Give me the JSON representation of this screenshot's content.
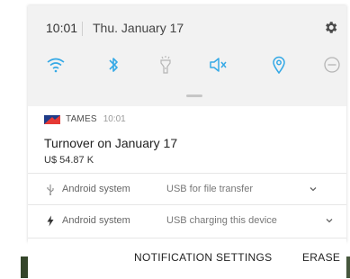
{
  "status": {
    "time": "10:01",
    "date": "Thu. January 17"
  },
  "quick_settings": [
    {
      "name": "wifi",
      "active": true
    },
    {
      "name": "bluetooth",
      "active": true
    },
    {
      "name": "flashlight",
      "active": false
    },
    {
      "name": "sound-off",
      "active": true
    },
    {
      "name": "location",
      "active": true
    },
    {
      "name": "do-not-disturb",
      "active": false
    }
  ],
  "notification": {
    "app": "TAMES",
    "time": "10:01",
    "title": "Turnover on January 17",
    "body": "U$ 54.87 K"
  },
  "system_notifications": [
    {
      "app": "Android system",
      "text": "USB for file transfer",
      "icon": "usb-icon"
    },
    {
      "app": "Android system",
      "text": "USB charging this device",
      "icon": "charging-icon"
    }
  ],
  "actions": {
    "settings": "NOTIFICATION SETTINGS",
    "erase": "ERASE"
  },
  "colors": {
    "accent": "#35a9e6",
    "header_bg": "#f2f2f2",
    "brand_red": "#e53935",
    "brand_blue": "#1f3c88"
  }
}
